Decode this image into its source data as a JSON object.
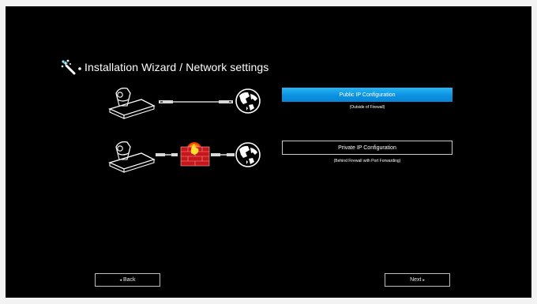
{
  "header": {
    "title": "Installation Wizard / Network settings",
    "icon": "magic-wand-icon"
  },
  "options": {
    "public": {
      "label": "Public IP Configuration",
      "subtitle": "(Outside of Firewall)",
      "selected": true,
      "accent": "#1ea4ee"
    },
    "private": {
      "label": "Private IP Configuration",
      "subtitle": "(Behind Firewall with Port Forwarding)",
      "selected": false
    }
  },
  "icons": {
    "camera": "camera-codec-icon",
    "cable": "network-cable-icon",
    "firewall": "firewall-icon",
    "globe": "globe-icon"
  },
  "footer": {
    "back_label": "Back",
    "back_arrow": "◂",
    "next_label": "Next",
    "next_arrow": "▸"
  }
}
